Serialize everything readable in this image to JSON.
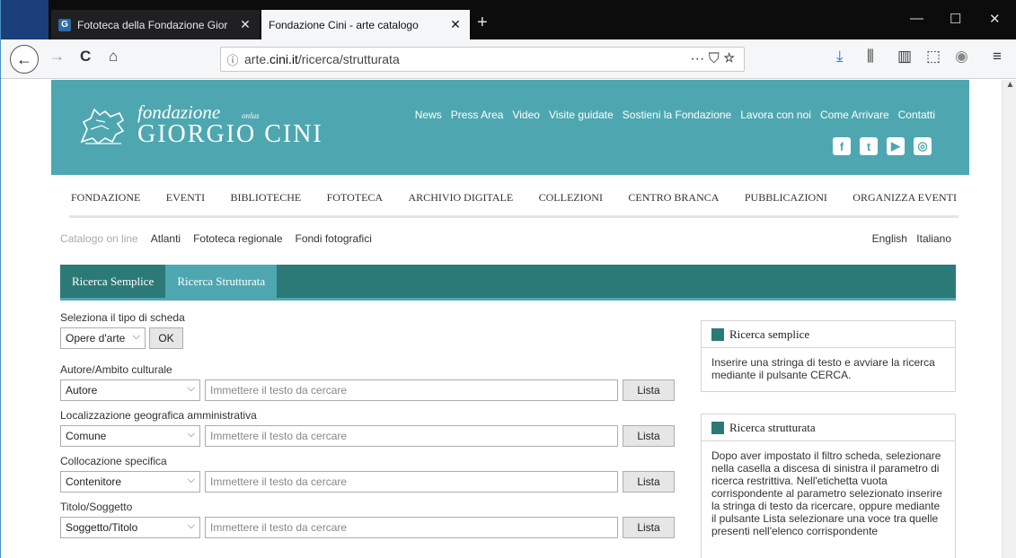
{
  "browser": {
    "tabs": [
      {
        "title": "Fototeca della Fondazione Gior",
        "favicon": "G",
        "close": "✕"
      },
      {
        "title": "Fondazione Cini - arte catalogo",
        "close": "✕"
      }
    ],
    "new_tab": "+",
    "window_controls": {
      "minimize": "—",
      "maximize": "☐",
      "close": "✕"
    },
    "url_info": "ⓘ",
    "url_prefix": "arte.",
    "url_domain": "cini.it",
    "url_path": "/ricerca/strutturata",
    "url_actions": "··· ⛉ ☆",
    "toolbar_icons": {
      "download": "⤓",
      "library": "⫼",
      "sidebar": "▥",
      "screenshot": "⬚",
      "extension": "◉",
      "menu": "≡"
    },
    "nav_icons": {
      "back": "←",
      "forward": "→",
      "reload": "C",
      "home": "⌂"
    }
  },
  "header": {
    "logo_fondazione": "fondazione",
    "logo_onlus": "onlus",
    "logo_name": "GIORGIO CINI",
    "top_links": [
      "News",
      "Press Area",
      "Video",
      "Visite guidate",
      "Sostieni la Fondazione",
      "Lavora con noi",
      "Come Arrivare",
      "Contatti"
    ],
    "social": [
      "f",
      "t",
      "▶",
      "◎"
    ]
  },
  "main_nav": [
    "FONDAZIONE",
    "EVENTI",
    "BIBLIOTECHE",
    "FOTOTECA",
    "ARCHIVIO DIGITALE",
    "COLLEZIONI",
    "CENTRO BRANCA",
    "PUBBLICAZIONI",
    "ORGANIZZA EVENTI"
  ],
  "sub_nav": {
    "items": [
      "Catalogo on line",
      "Atlanti",
      "Fototeca regionale",
      "Fondi fotografici"
    ],
    "lang": [
      "English",
      "Italiano"
    ]
  },
  "search_tabs": [
    "Ricerca Semplice",
    "Ricerca Strutturata"
  ],
  "form": {
    "tipo_label": "Seleziona il tipo di scheda",
    "tipo_value": "Opere d'arte",
    "ok": "OK",
    "placeholder": "Immettere il testo da cercare",
    "lista": "Lista",
    "fields": [
      {
        "label": "Autore/Ambito culturale",
        "select": "Autore"
      },
      {
        "label": "Localizzazione geografica amministrativa",
        "select": "Comune"
      },
      {
        "label": "Collocazione specifica",
        "select": "Contenitore"
      },
      {
        "label": "Titolo/Soggetto",
        "select": "Soggetto/Titolo"
      }
    ]
  },
  "sidebar": {
    "semplice_title": "Ricerca semplice",
    "semplice_text": "Inserire una stringa di testo e avviare la ricerca mediante il pulsante CERCA.",
    "strutturata_title": "Ricerca strutturata",
    "strutturata_text": "Dopo aver impostato il filtro scheda, selezionare nella casella a discesa di sinistra il parametro di ricerca restrittiva. Nell'etichetta vuota corrispondente al parametro selezionato inserire la stringa di testo da ricercare, oppure mediante il pulsante Lista selezionare una voce tra quelle presenti nell'elenco corrispondente"
  }
}
